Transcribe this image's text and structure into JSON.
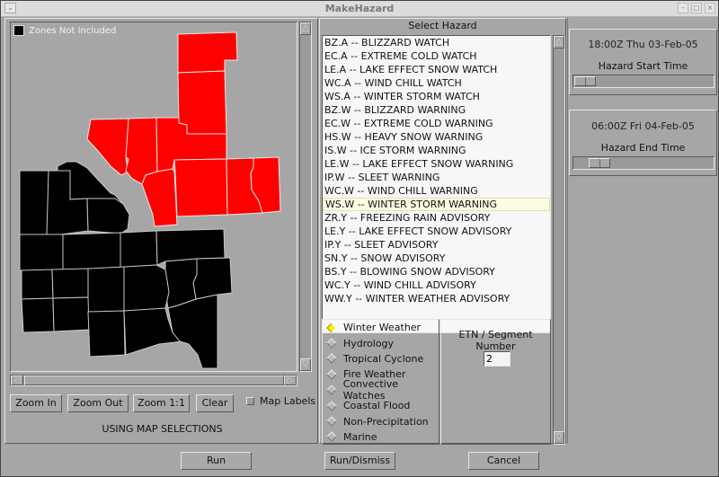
{
  "window": {
    "title": "MakeHazard",
    "controls": [
      "minimize",
      "maximize",
      "close"
    ]
  },
  "map": {
    "legend_label": "Zones Not Included",
    "legend_color": "#000000",
    "selected_color": "#ff0000",
    "buttons": {
      "zoom_in": "Zoom In",
      "zoom_out": "Zoom Out",
      "zoom_1_1": "Zoom 1:1",
      "clear": "Clear"
    },
    "map_labels_checkbox": {
      "label": "Map Labels",
      "checked": false
    },
    "status": "USING MAP SELECTIONS"
  },
  "hazard": {
    "title": "Select Hazard",
    "items": [
      "BZ.A -- BLIZZARD WATCH",
      "EC.A -- EXTREME COLD WATCH",
      "LE.A -- LAKE EFFECT SNOW WATCH",
      "WC.A -- WIND CHILL WATCH",
      "WS.A -- WINTER STORM WATCH",
      "BZ.W -- BLIZZARD WARNING",
      "EC.W -- EXTREME COLD WARNING",
      "HS.W -- HEAVY SNOW WARNING",
      "IS.W -- ICE STORM WARNING",
      "LE.W -- LAKE EFFECT SNOW WARNING",
      "IP.W -- SLEET WARNING",
      "WC.W -- WIND CHILL WARNING",
      "WS.W -- WINTER STORM WARNING",
      "ZR.Y -- FREEZING RAIN ADVISORY",
      "LE.Y -- LAKE EFFECT SNOW ADVISORY",
      "IP.Y -- SLEET ADVISORY",
      "SN.Y -- SNOW ADVISORY",
      "BS.Y -- BLOWING SNOW ADVISORY",
      "WC.Y -- WIND CHILL ADVISORY",
      "WW.Y -- WINTER WEATHER ADVISORY"
    ],
    "selected_index": 12,
    "categories": [
      "Winter Weather",
      "Hydrology",
      "Tropical Cyclone",
      "Fire Weather",
      "Convective Watches",
      "Coastal Flood",
      "Non-Precipitation",
      "Marine"
    ],
    "selected_category": 0,
    "etn_label": "ETN / Segment Number",
    "etn_value": "2"
  },
  "times": {
    "start": {
      "value": "18:00Z Thu 03-Feb-05",
      "label": "Hazard Start Time",
      "slider_fraction": 0.0
    },
    "end": {
      "value": "06:00Z Fri 04-Feb-05",
      "label": "Hazard End Time",
      "slider_fraction": 0.12
    }
  },
  "footer": {
    "run": "Run",
    "run_dismiss": "Run/Dismiss",
    "cancel": "Cancel"
  }
}
